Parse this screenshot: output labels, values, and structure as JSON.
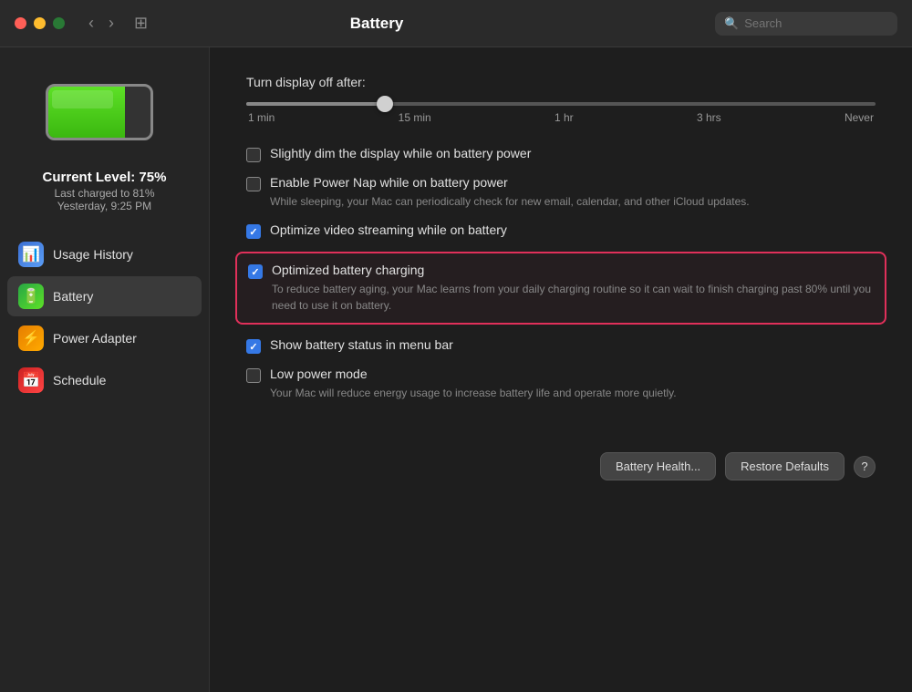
{
  "titlebar": {
    "title": "Battery",
    "search_placeholder": "Search"
  },
  "sidebar": {
    "battery_icon_alt": "Battery icon",
    "current_level_label": "Current Level: 75%",
    "last_charged_label": "Last charged to 81%",
    "last_charged_date": "Yesterday, 9:25 PM",
    "items": [
      {
        "id": "usage-history",
        "label": "Usage History",
        "icon": "📊",
        "icon_class": "icon-usage",
        "active": false
      },
      {
        "id": "battery",
        "label": "Battery",
        "icon": "🔋",
        "icon_class": "icon-battery",
        "active": true
      },
      {
        "id": "power-adapter",
        "label": "Power Adapter",
        "icon": "⚡",
        "icon_class": "icon-power",
        "active": false
      },
      {
        "id": "schedule",
        "label": "Schedule",
        "icon": "📅",
        "icon_class": "icon-schedule",
        "active": false
      }
    ]
  },
  "content": {
    "slider": {
      "label": "Turn display off after:",
      "ticks": [
        "1 min",
        "15 min",
        "1 hr",
        "3 hrs",
        "Never"
      ],
      "value_position": 22
    },
    "options": [
      {
        "id": "dim-display",
        "label": "Slightly dim the display while on battery power",
        "description": "",
        "checked": false,
        "highlighted": false
      },
      {
        "id": "power-nap",
        "label": "Enable Power Nap while on battery power",
        "description": "While sleeping, your Mac can periodically check for new email, calendar, and other iCloud updates.",
        "checked": false,
        "highlighted": false
      },
      {
        "id": "video-streaming",
        "label": "Optimize video streaming while on battery",
        "description": "",
        "checked": true,
        "highlighted": false
      },
      {
        "id": "optimized-charging",
        "label": "Optimized battery charging",
        "description": "To reduce battery aging, your Mac learns from your daily charging routine so it can wait to finish charging past 80% until you need to use it on battery.",
        "checked": true,
        "highlighted": true
      },
      {
        "id": "menu-bar",
        "label": "Show battery status in menu bar",
        "description": "",
        "checked": true,
        "highlighted": false
      },
      {
        "id": "low-power",
        "label": "Low power mode",
        "description": "Your Mac will reduce energy usage to increase battery life and operate more quietly.",
        "checked": false,
        "highlighted": false
      }
    ],
    "buttons": {
      "battery_health": "Battery Health...",
      "restore_defaults": "Restore Defaults",
      "help": "?"
    }
  }
}
